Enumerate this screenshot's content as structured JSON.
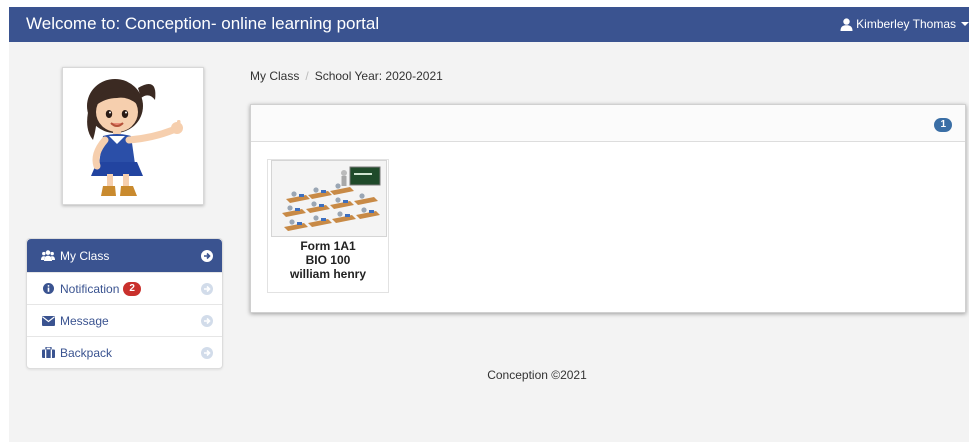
{
  "header": {
    "title": "Welcome to: Conception- online learning portal",
    "user_name": "Kimberley Thomas",
    "user_icon": "user-icon",
    "color": "#3a5390"
  },
  "breadcrumb": {
    "items": [
      "My Class",
      "School Year: 2020-2021"
    ]
  },
  "sidebar": {
    "items": [
      {
        "label": "My Class",
        "icon": "users-icon",
        "active": true
      },
      {
        "label": "Notification",
        "icon": "info-icon",
        "badge": "2"
      },
      {
        "label": "Message",
        "icon": "envelope-icon"
      },
      {
        "label": "Backpack",
        "icon": "briefcase-icon"
      }
    ]
  },
  "panel": {
    "count_badge": "1",
    "classes": [
      {
        "form": "Form 1A1",
        "subject": "BIO 100",
        "teacher": "william henry"
      }
    ]
  },
  "footer": {
    "text": "Conception ©2021"
  }
}
